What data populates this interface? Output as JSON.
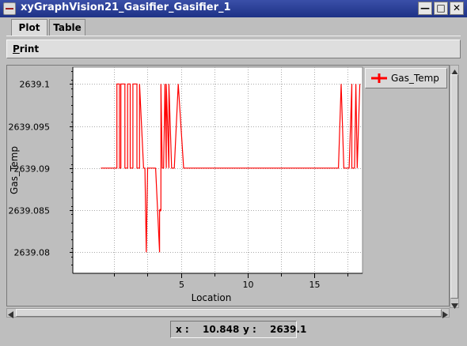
{
  "window": {
    "title": "xyGraphVision21_Gasifier_Gasifier_1",
    "minimize_glyph": "—",
    "maximize_glyph": "□",
    "close_glyph": "✕"
  },
  "tabs": [
    {
      "label": "Plot",
      "active": true
    },
    {
      "label": "Table",
      "active": false
    }
  ],
  "toolbar": {
    "print_label": "Print"
  },
  "legend": {
    "label": "Gas_Temp",
    "color": "#ff0000"
  },
  "status": {
    "x_label": "x :",
    "x_value": "10.848",
    "y_label": "y :",
    "y_value": "2639.1"
  },
  "chart_data": {
    "type": "line",
    "xlabel": "Location",
    "ylabel": "Gas_Temp",
    "xlim": [
      -3.1,
      18.6
    ],
    "ylim": [
      2639.0775,
      2639.102
    ],
    "xticks": [
      5,
      10,
      15
    ],
    "yticks": [
      2639.08,
      2639.085,
      2639.09,
      2639.095,
      2639.1
    ],
    "ytick_labels": [
      "2639.08",
      "2639.085",
      "2639.09",
      "2639.095",
      "2639.1"
    ],
    "grid": true,
    "series": [
      {
        "name": "Gas_Temp",
        "color": "#ff0000",
        "x": [
          -1.0,
          0.2,
          0.2,
          0.4,
          0.4,
          0.5,
          0.5,
          0.8,
          0.8,
          1.0,
          1.0,
          1.2,
          1.2,
          1.4,
          1.4,
          1.7,
          1.7,
          1.9,
          1.9,
          2.2,
          2.3,
          2.4,
          2.5,
          2.7,
          2.8,
          3.1,
          3.4,
          3.4,
          3.5,
          3.5,
          3.6,
          3.7,
          3.8,
          3.9,
          3.9,
          4.1,
          4.1,
          4.3,
          4.5,
          4.8,
          5.2,
          16.5,
          16.8,
          17.0,
          17.2,
          17.4,
          17.6,
          17.8,
          17.8,
          18.0,
          18.1,
          18.2,
          18.4
        ],
        "y": [
          2639.09,
          2639.09,
          2639.1,
          2639.1,
          2639.09,
          2639.09,
          2639.1,
          2639.1,
          2639.09,
          2639.09,
          2639.1,
          2639.1,
          2639.09,
          2639.09,
          2639.1,
          2639.1,
          2639.09,
          2639.09,
          2639.1,
          2639.09,
          2639.09,
          2639.08,
          2639.09,
          2639.09,
          2639.09,
          2639.09,
          2639.08,
          2639.085,
          2639.085,
          2639.1,
          2639.09,
          2639.09,
          2639.1,
          2639.09,
          2639.1,
          2639.09,
          2639.1,
          2639.09,
          2639.09,
          2639.1,
          2639.09,
          2639.09,
          2639.09,
          2639.1,
          2639.09,
          2639.09,
          2639.09,
          2639.1,
          2639.09,
          2639.09,
          2639.1,
          2639.09,
          2639.1
        ]
      }
    ]
  }
}
